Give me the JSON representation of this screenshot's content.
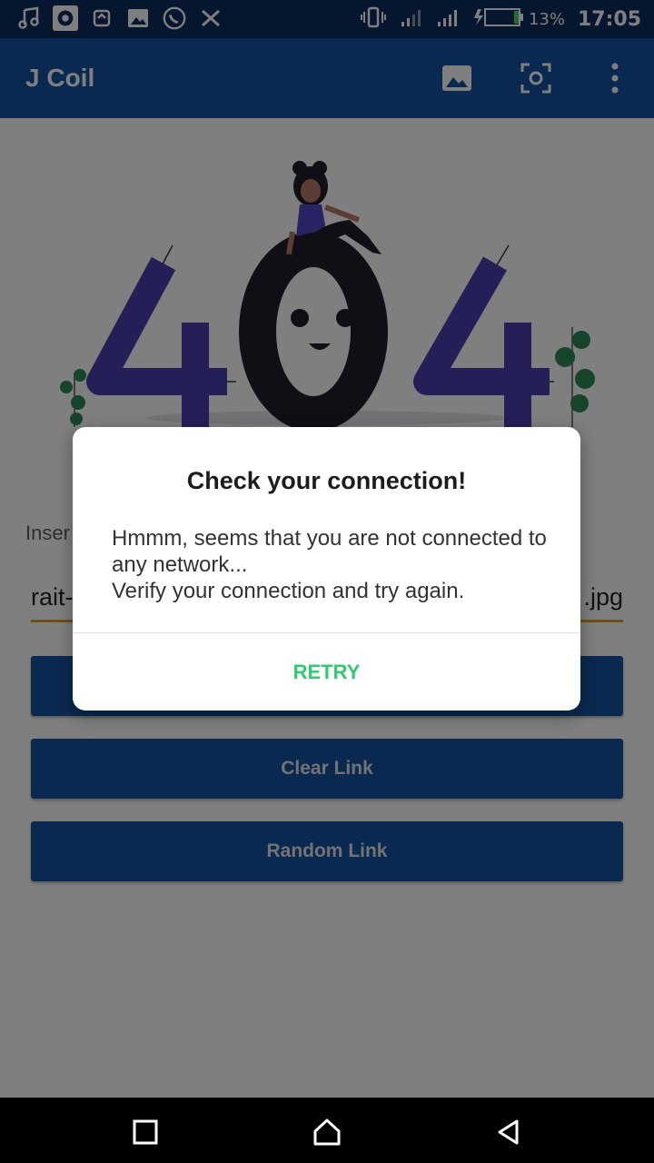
{
  "status_bar": {
    "battery_percent": "13%",
    "time": "17:05",
    "left_icons": [
      "music-note-icon",
      "tiles-app-icon",
      "sync-icon",
      "image-icon",
      "whatsapp-icon",
      "x-icon"
    ],
    "right_icons": [
      "vibrate-icon",
      "signal-weak-icon",
      "signal-icon",
      "battery-charging-icon"
    ]
  },
  "app_bar": {
    "title": "J Coil",
    "actions": [
      "image-icon",
      "scan-icon",
      "more-vert-icon"
    ]
  },
  "illustration": {
    "text": "404"
  },
  "main": {
    "insert_label": "Inser",
    "link_value_left": "rait-",
    "link_value_right": ".jpg",
    "buttons": {
      "clear": "Clear Link",
      "random": "Random Link"
    }
  },
  "dialog": {
    "title": "Check your connection!",
    "message_line1": "Hmmm, seems that you are not connected to any network...",
    "message_line2": "Verify your connection and try again.",
    "retry": "RETRY"
  },
  "colors": {
    "status_bar": "#0b2d5c",
    "app_bar": "#1552a3",
    "button": "#1552a3",
    "retry_text": "#2ecc71",
    "field_underline": "#e0a020",
    "digit_four": "#4a3fb0",
    "digit_zero": "#1f1f2b"
  }
}
